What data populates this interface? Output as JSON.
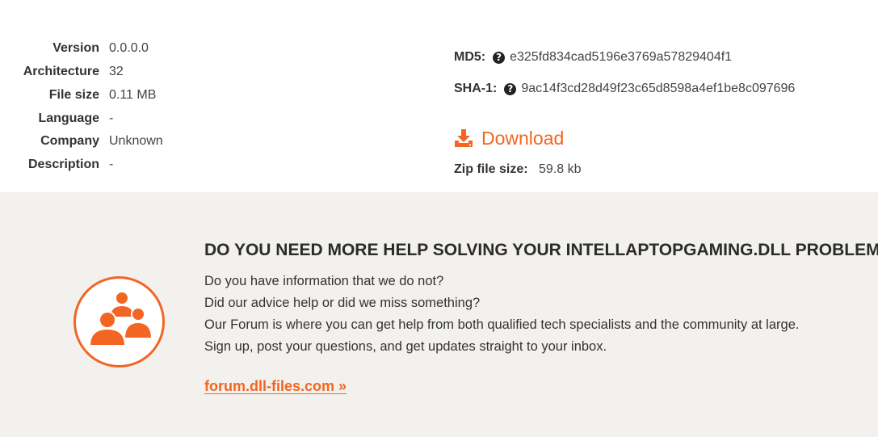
{
  "file_info": {
    "rows": [
      {
        "label": "Version",
        "value": "0.0.0.0"
      },
      {
        "label": "Architecture",
        "value": "32"
      },
      {
        "label": "File size",
        "value": "0.11 MB"
      },
      {
        "label": "Language",
        "value": "-"
      },
      {
        "label": "Company",
        "value": "Unknown"
      },
      {
        "label": "Description",
        "value": "-"
      }
    ]
  },
  "hashes": {
    "md5_label": "MD5:",
    "md5_value": "e325fd834cad5196e3769a57829404f1",
    "sha1_label": "SHA-1:",
    "sha1_value": "9ac14f3cd28d49f23c65d8598a4ef1be8c097696",
    "help_icon": "question-circle-icon"
  },
  "download": {
    "label": "Download",
    "icon": "download-icon",
    "zip_label": "Zip file size:",
    "zip_value": "59.8 kb"
  },
  "help_section": {
    "title": "DO YOU NEED MORE HELP SOLVING YOUR INTELLAPTOPGAMING.DLL PROBLEM?",
    "lines": [
      "Do you have information that we do not?",
      "Did our advice help or did we miss something?",
      "Our Forum is where you can get help from both qualified tech specialists and the community at large.",
      "Sign up, post your questions, and get updates straight to your inbox."
    ],
    "link": "forum.dll-files.com »",
    "icon": "forum-users-icon"
  },
  "colors": {
    "accent": "#f26522",
    "help_background": "#f3f1ee"
  }
}
